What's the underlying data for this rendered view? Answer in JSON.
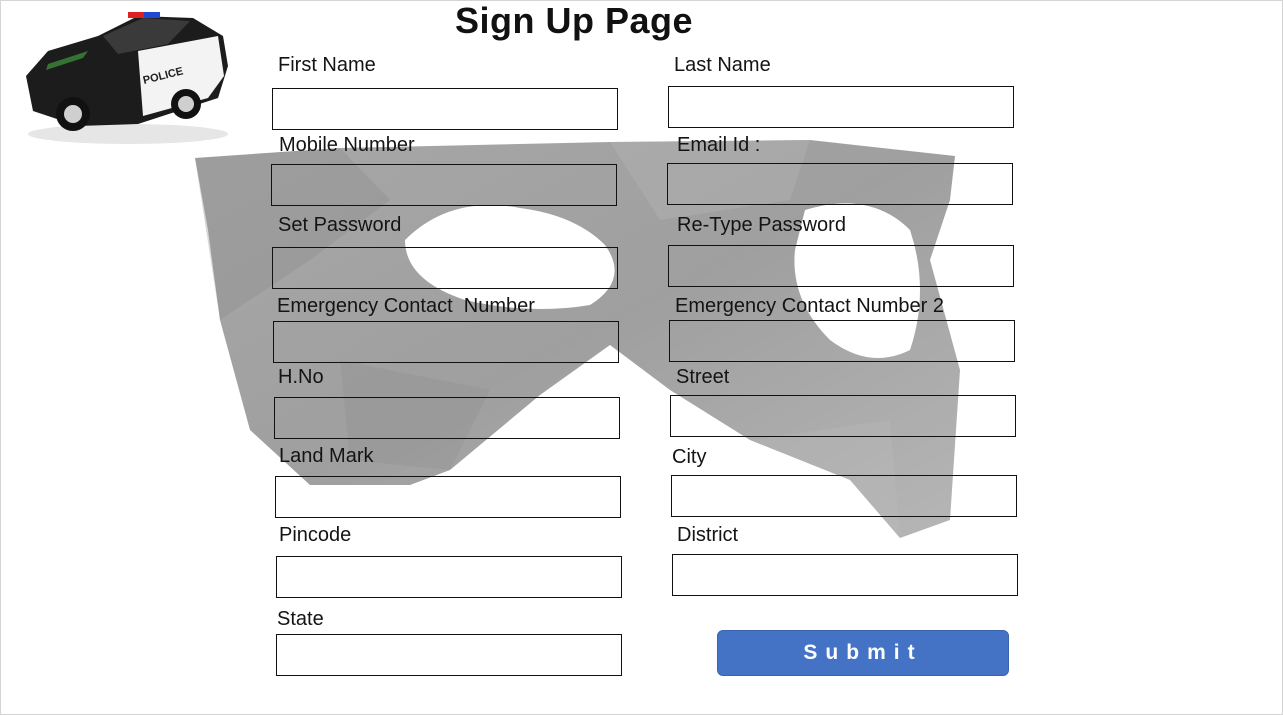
{
  "page": {
    "title": "Sign Up Page"
  },
  "images": {
    "logo": "police-car",
    "watermark": "mask"
  },
  "fields": [
    {
      "label": "First Name",
      "value": "",
      "placeholder": ""
    },
    {
      "label": "Last Name",
      "value": "",
      "placeholder": ""
    },
    {
      "label": "Mobile Number",
      "value": "",
      "placeholder": ""
    },
    {
      "label": "Email Id :",
      "value": "",
      "placeholder": ""
    },
    {
      "label": "Set Password",
      "value": "",
      "placeholder": ""
    },
    {
      "label": "Re-Type Password",
      "value": "",
      "placeholder": ""
    },
    {
      "label": "Emergency Contact  Number",
      "value": "",
      "placeholder": ""
    },
    {
      "label": "Emergency Contact Number 2",
      "value": "",
      "placeholder": ""
    },
    {
      "label": "H.No",
      "value": "",
      "placeholder": ""
    },
    {
      "label": "Street",
      "value": "",
      "placeholder": ""
    },
    {
      "label": "Land Mark",
      "value": "",
      "placeholder": ""
    },
    {
      "label": "City",
      "value": "",
      "placeholder": ""
    },
    {
      "label": "Pincode",
      "value": "",
      "placeholder": ""
    },
    {
      "label": "District",
      "value": "",
      "placeholder": ""
    },
    {
      "label": "State",
      "value": "",
      "placeholder": ""
    }
  ],
  "submit": {
    "label": "Submit"
  },
  "colors": {
    "submit_bg": "#4472c4",
    "submit_text": "#ffffff",
    "mask": "#9e9e9e"
  }
}
